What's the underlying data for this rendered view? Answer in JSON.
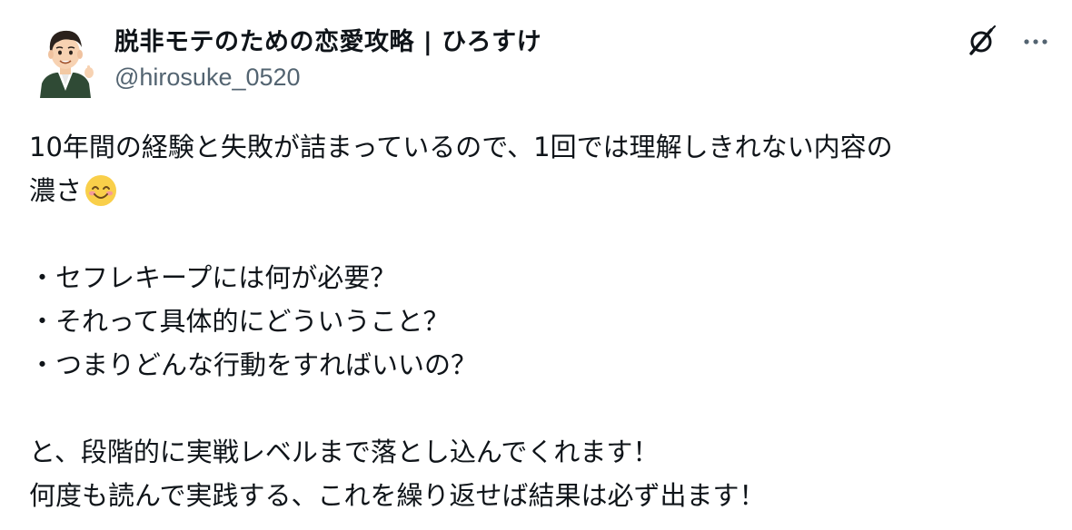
{
  "author": {
    "display_name": "脱非モテのための恋愛攻略 | ひろすけ",
    "handle": "@hirosuke_0520",
    "avatar_icon": "cartoon-man-avatar"
  },
  "actions": {
    "grok_icon": "grok-icon",
    "more_icon": "more-horizontal-icon"
  },
  "post": {
    "lines": [
      "10年間の経験と失敗が詰まっているので、1回では理解しきれない内容の",
      "濃さ",
      "",
      "・セフレキープには何が必要？",
      "・それって具体的にどういうこと？",
      "・つまりどんな行動をすればいいの？",
      "",
      "と、段階的に実戦レベルまで落とし込んでくれます！",
      "何度も読んで実践する、これを繰り返せば結果は必ず出ます！"
    ],
    "emoji": "smiling-face-with-smiling-eyes"
  }
}
